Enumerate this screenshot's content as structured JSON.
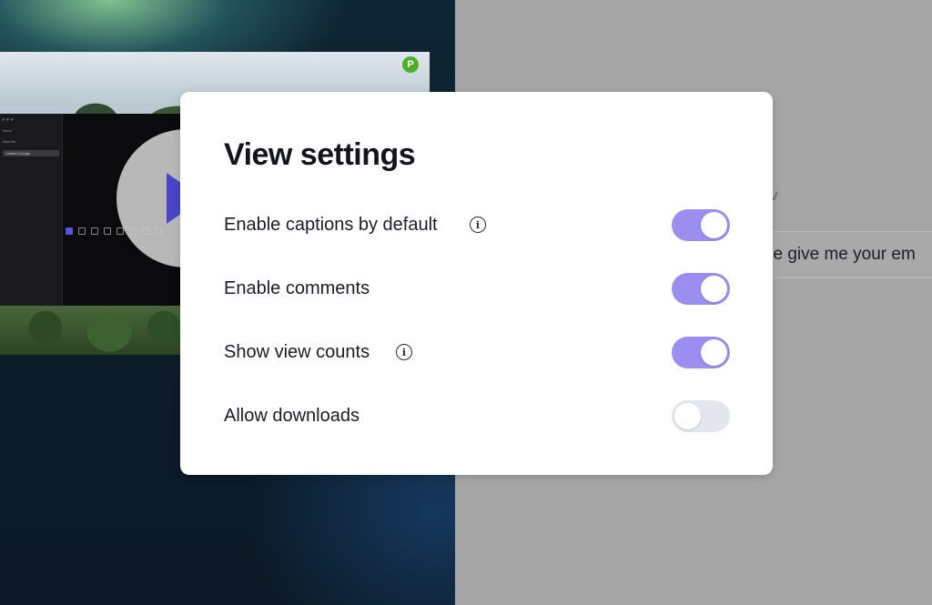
{
  "modal": {
    "title": "View settings",
    "settings": [
      {
        "label": "Enable captions by default",
        "has_info": true,
        "enabled": true
      },
      {
        "label": "Enable comments",
        "has_info": false,
        "enabled": true
      },
      {
        "label": "Show view counts",
        "has_info": true,
        "enabled": true
      },
      {
        "label": "Allow downloads",
        "has_info": false,
        "enabled": false
      }
    ],
    "toggle_on_color": "#9b8ef0",
    "toggle_off_color": "#e3e6ee"
  },
  "background": {
    "partial_label": "v",
    "partial_input_text": "se give me your em"
  },
  "preview": {
    "app_logo_letter": "P",
    "sidebar_items": [
      "Inbox",
      "New file",
      "Untitled Design"
    ]
  },
  "icons": {
    "info": "info-icon",
    "play": "play-icon"
  }
}
